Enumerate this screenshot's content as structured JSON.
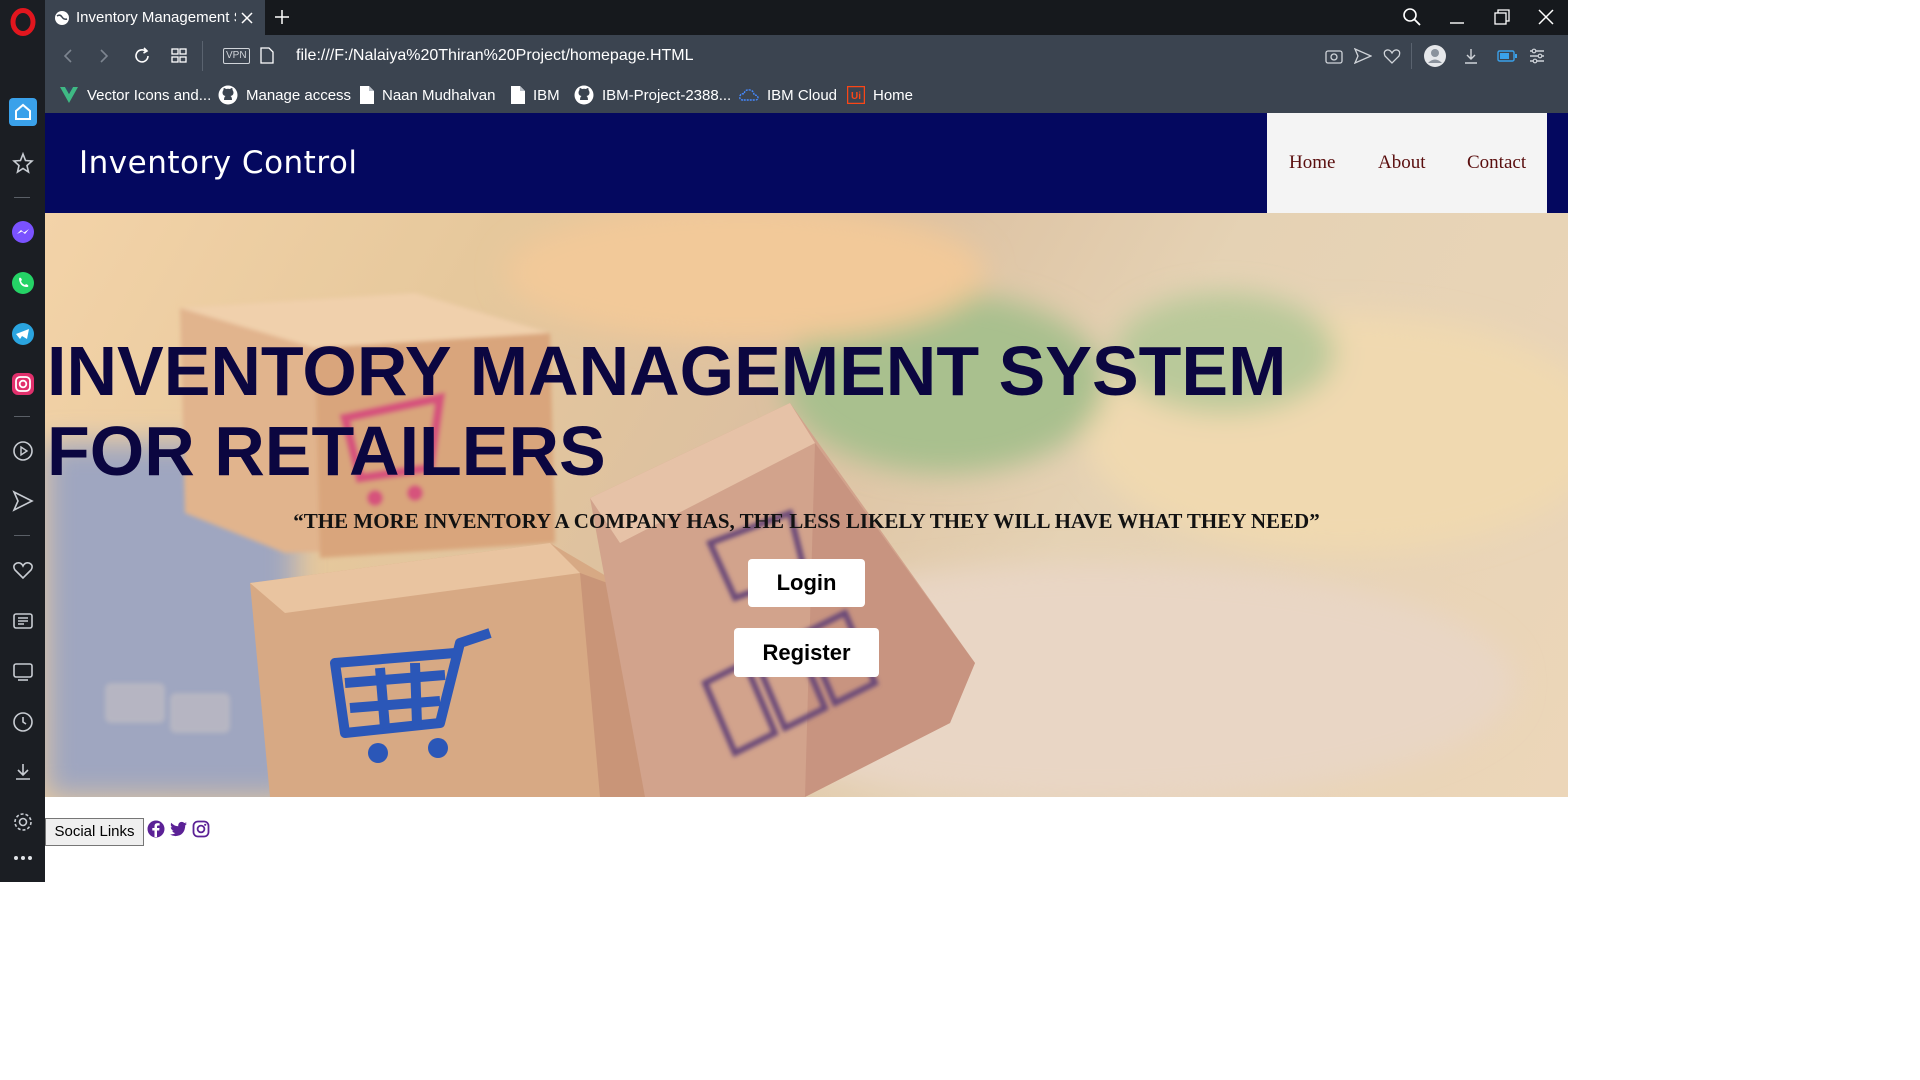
{
  "browser": {
    "tab_title": "Inventory Management S",
    "url": "file:///F:/Nalaiya%20Thiran%20Project/homepage.HTML",
    "vpn_label": "VPN",
    "bookmarks": [
      {
        "label": "Vector Icons and..."
      },
      {
        "label": "Manage access"
      },
      {
        "label": "Naan Mudhalvan"
      },
      {
        "label": "IBM"
      },
      {
        "label": "IBM-Project-2388..."
      },
      {
        "label": "IBM Cloud"
      },
      {
        "label": "Home"
      }
    ]
  },
  "page": {
    "brand": "Inventory Control",
    "nav": {
      "home": "Home",
      "about": "About",
      "contact": "Contact"
    },
    "hero_title": "INVENTORY MANAGEMENT SYSTEM FOR RETAILERS",
    "quote": "“THE MORE INVENTORY A COMPANY HAS, THE LESS LIKELY THEY WILL HAVE WHAT THEY NEED”",
    "login_label": "Login",
    "register_label": "Register",
    "social_label": "Social Links"
  },
  "colors": {
    "navbar": "#04085f",
    "hero_title": "#0b0640",
    "nav_link": "#5a0e0e",
    "social_icon": "#5b2196"
  },
  "icons": {
    "sidebar": [
      "opera-logo-icon",
      "home-icon",
      "star-icon",
      "messenger-icon",
      "whatsapp-icon",
      "telegram-icon",
      "instagram-icon",
      "player-icon",
      "send-icon",
      "heart-icon",
      "news-icon",
      "tab-list-icon",
      "history-icon",
      "download-icon",
      "settings-icon",
      "more-icon"
    ],
    "social": [
      "facebook-icon",
      "twitter-icon",
      "instagram-icon"
    ]
  }
}
